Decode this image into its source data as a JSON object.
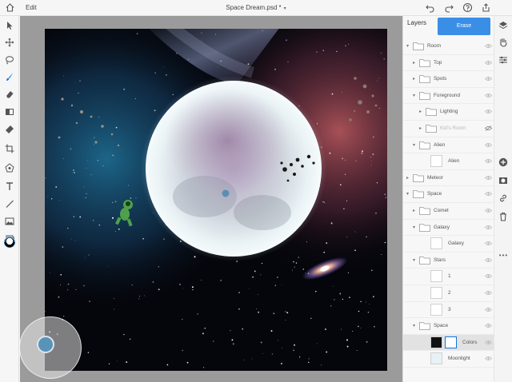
{
  "topbar": {
    "edit_label": "Edit",
    "document_title": "Space Dream.psd *",
    "icons": [
      "home-icon",
      "undo-icon",
      "redo-icon",
      "help-icon",
      "share-icon"
    ]
  },
  "toolbar": {
    "tools": [
      "move-icon",
      "transform-icon",
      "lasso-icon",
      "brush-icon",
      "eraser-icon",
      "gradient-icon",
      "healing-icon",
      "crop-icon",
      "shape-icon",
      "type-icon",
      "line-icon",
      "image-icon",
      "color-swatch-icon"
    ],
    "brush_size": "650"
  },
  "layers_panel": {
    "title": "Layers",
    "erase_button": "Erase",
    "layers": [
      {
        "name": "Room",
        "kind": "group",
        "depth": 0,
        "open": true
      },
      {
        "name": "Top",
        "kind": "group",
        "depth": 1,
        "open": false
      },
      {
        "name": "Spots",
        "kind": "group",
        "depth": 1,
        "open": false
      },
      {
        "name": "Foreground",
        "kind": "group",
        "depth": 1,
        "open": true
      },
      {
        "name": "Lighting",
        "kind": "group",
        "depth": 2,
        "open": false
      },
      {
        "name": "Kid's Room",
        "kind": "group",
        "depth": 2,
        "open": false,
        "hidden": true
      },
      {
        "name": "Alien",
        "kind": "group",
        "depth": 1,
        "open": true
      },
      {
        "name": "Alien",
        "kind": "layer",
        "depth": 2
      },
      {
        "name": "Meteor",
        "kind": "group",
        "depth": 0,
        "open": false
      },
      {
        "name": "Space",
        "kind": "group",
        "depth": 0,
        "open": true
      },
      {
        "name": "Comet",
        "kind": "group",
        "depth": 1,
        "open": false
      },
      {
        "name": "Galaxy",
        "kind": "group",
        "depth": 1,
        "open": true
      },
      {
        "name": "Galaxy",
        "kind": "layer",
        "depth": 2
      },
      {
        "name": "Stars",
        "kind": "group",
        "depth": 1,
        "open": true
      },
      {
        "name": "1",
        "kind": "layer",
        "depth": 2
      },
      {
        "name": "2",
        "kind": "layer",
        "depth": 2
      },
      {
        "name": "3",
        "kind": "layer",
        "depth": 2
      },
      {
        "name": "Space",
        "kind": "group",
        "depth": 1,
        "open": true
      },
      {
        "name": "Colors",
        "kind": "layer",
        "depth": 2,
        "selected": true,
        "mask": true
      },
      {
        "name": "Moonlight",
        "kind": "layer",
        "depth": 2
      }
    ]
  },
  "rightbar": {
    "icons": [
      "layers-icon",
      "layer-properties-icon",
      "adjustments-icon",
      "add-layer-icon",
      "mask-icon",
      "link-icon",
      "delete-icon",
      "more-icon"
    ]
  },
  "colors": {
    "accent": "#1473e6",
    "erase_button": "#3a8ee6",
    "canvas_bg": "#05060c",
    "moon": "#e8f1f4"
  }
}
